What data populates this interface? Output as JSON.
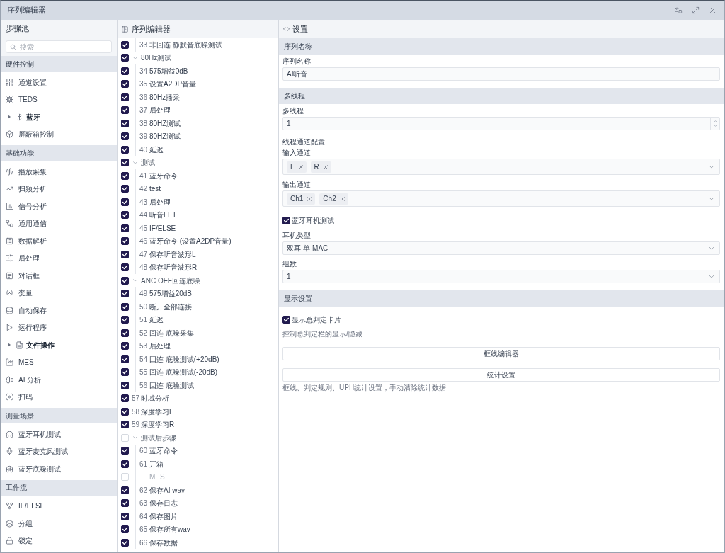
{
  "window": {
    "title": "序列编辑器"
  },
  "step_pool": {
    "title": "步骤池",
    "search": {
      "placeholder": "搜索"
    },
    "sections": [
      {
        "title": "硬件控制",
        "items": [
          {
            "kind": "tool",
            "label": "通道设置"
          },
          {
            "kind": "tool",
            "label": "TEDS"
          },
          {
            "kind": "group",
            "label": "蓝牙",
            "expanded": false
          },
          {
            "kind": "tool",
            "label": "屏蔽箱控制"
          }
        ]
      },
      {
        "title": "基础功能",
        "items": [
          {
            "kind": "tool",
            "label": "播放采集"
          },
          {
            "kind": "tool",
            "label": "扫频分析"
          },
          {
            "kind": "tool",
            "label": "信号分析"
          },
          {
            "kind": "tool",
            "label": "通用通信"
          },
          {
            "kind": "tool",
            "label": "数据解析"
          },
          {
            "kind": "tool",
            "label": "后处理"
          },
          {
            "kind": "tool",
            "label": "对话框"
          },
          {
            "kind": "tool",
            "label": "变量"
          },
          {
            "kind": "tool",
            "label": "自动保存"
          },
          {
            "kind": "tool",
            "label": "运行程序"
          },
          {
            "kind": "group",
            "label": "文件操作",
            "expanded": false
          },
          {
            "kind": "tool",
            "label": "MES"
          },
          {
            "kind": "tool",
            "label": "AI 分析"
          },
          {
            "kind": "tool",
            "label": "扫码"
          }
        ]
      },
      {
        "title": "测量场景",
        "items": [
          {
            "kind": "tool",
            "label": "蓝牙耳机测试"
          },
          {
            "kind": "tool",
            "label": "蓝牙麦克风测试"
          },
          {
            "kind": "tool",
            "label": "蓝牙底噪测试"
          }
        ]
      },
      {
        "title": "工作流",
        "items": [
          {
            "kind": "tool",
            "label": "IF/ELSE"
          },
          {
            "kind": "tool",
            "label": "分组"
          },
          {
            "kind": "tool",
            "label": "锁定"
          }
        ]
      }
    ]
  },
  "sequence_editor": {
    "title": "序列编辑器",
    "steps": [
      {
        "kind": "group",
        "children": [
          {
            "kind": "step",
            "number": "33",
            "label": "非回连 静默音底噪测试",
            "checked": true,
            "disabled": false
          }
        ]
      },
      {
        "kind": "group",
        "label": "80Hz测试",
        "checked": true,
        "expanded": true,
        "disabled": false,
        "children": [
          {
            "kind": "step",
            "number": "34",
            "label": "575增益0dB",
            "checked": true,
            "disabled": false
          },
          {
            "kind": "step",
            "number": "35",
            "label": "设置A2DP音量",
            "checked": true,
            "disabled": false
          },
          {
            "kind": "step",
            "number": "36",
            "label": "80Hz播采",
            "checked": true,
            "disabled": false
          },
          {
            "kind": "step",
            "number": "37",
            "label": "后处理",
            "checked": true,
            "disabled": false
          },
          {
            "kind": "step",
            "number": "38",
            "label": "80HZ测试",
            "checked": true,
            "disabled": false
          },
          {
            "kind": "step",
            "number": "39",
            "label": "80HZ测试",
            "checked": true,
            "disabled": false
          },
          {
            "kind": "step",
            "number": "40",
            "label": "延迟",
            "checked": true,
            "disabled": false
          }
        ]
      },
      {
        "kind": "group",
        "label": "测试",
        "checked": true,
        "expanded": true,
        "disabled": false,
        "children": [
          {
            "kind": "step",
            "number": "41",
            "label": "蓝牙命令",
            "checked": true,
            "disabled": false
          },
          {
            "kind": "step",
            "number": "42",
            "label": "test",
            "checked": true,
            "disabled": false
          },
          {
            "kind": "step",
            "number": "43",
            "label": "后处理",
            "checked": true,
            "disabled": false
          },
          {
            "kind": "step",
            "number": "44",
            "label": "听音FFT",
            "checked": true,
            "disabled": false
          },
          {
            "kind": "step",
            "number": "45",
            "label": "IF/ELSE",
            "checked": true,
            "disabled": false
          },
          {
            "kind": "step",
            "number": "46",
            "label": "蓝牙命令 (设置A2DP音量)",
            "checked": true,
            "disabled": false
          },
          {
            "kind": "step",
            "number": "47",
            "label": "保存听音波形L",
            "checked": true,
            "disabled": false
          },
          {
            "kind": "step",
            "number": "48",
            "label": "保存听音波形R",
            "checked": true,
            "disabled": false
          }
        ]
      },
      {
        "kind": "group",
        "label": "ANC OFF回连底噪",
        "checked": true,
        "expanded": true,
        "disabled": false,
        "children": [
          {
            "kind": "step",
            "number": "49",
            "label": "575增益20dB",
            "checked": true,
            "disabled": false
          },
          {
            "kind": "step",
            "number": "50",
            "label": "断开全部连接",
            "checked": true,
            "disabled": false
          },
          {
            "kind": "step",
            "number": "51",
            "label": "延迟",
            "checked": true,
            "disabled": false
          },
          {
            "kind": "step",
            "number": "52",
            "label": "回连 底噪采集",
            "checked": true,
            "disabled": false
          },
          {
            "kind": "step",
            "number": "53",
            "label": "后处理",
            "checked": true,
            "disabled": false
          },
          {
            "kind": "step",
            "number": "54",
            "label": "回连 底噪测试(+20dB)",
            "checked": true,
            "disabled": false
          },
          {
            "kind": "step",
            "number": "55",
            "label": "回连 底噪测试(-20dB)",
            "checked": true,
            "disabled": false
          },
          {
            "kind": "step",
            "number": "56",
            "label": "回连 底噪测试",
            "checked": true,
            "disabled": false
          }
        ]
      },
      {
        "kind": "step",
        "number": "57",
        "label": "时域分析",
        "checked": true,
        "disabled": false
      },
      {
        "kind": "step",
        "number": "58",
        "label": "深度学习L",
        "checked": true,
        "disabled": false
      },
      {
        "kind": "step",
        "number": "59",
        "label": "深度学习R",
        "checked": true,
        "disabled": false
      },
      {
        "kind": "group",
        "label": "测试后步骤",
        "checked": false,
        "expanded": true,
        "disabled": false,
        "children": [
          {
            "kind": "step",
            "number": "60",
            "label": "蓝牙命令",
            "checked": true,
            "disabled": false
          },
          {
            "kind": "step",
            "number": "61",
            "label": "开箱",
            "checked": true,
            "disabled": false
          },
          {
            "kind": "step",
            "label": "MES",
            "checked": false,
            "disabled": true
          },
          {
            "kind": "step",
            "number": "62",
            "label": "保存AI wav",
            "checked": true,
            "disabled": false
          },
          {
            "kind": "step",
            "number": "63",
            "label": "保存日志",
            "checked": true,
            "disabled": false
          },
          {
            "kind": "step",
            "number": "64",
            "label": "保存图片",
            "checked": true,
            "disabled": false
          },
          {
            "kind": "step",
            "number": "65",
            "label": "保存所有wav",
            "checked": true,
            "disabled": false
          },
          {
            "kind": "step",
            "number": "66",
            "label": "保存数据",
            "checked": true,
            "disabled": false
          }
        ]
      }
    ]
  },
  "settings": {
    "title": "设置",
    "sections": [
      {
        "title": "序列名称",
        "fields": [
          {
            "kind": "text",
            "label": "序列名称",
            "value": "AI听音"
          }
        ]
      },
      {
        "title": "多线程",
        "fields": [
          {
            "kind": "number",
            "label": "多线程",
            "value": "1"
          },
          {
            "kind": "heading",
            "label": "线程通道配置"
          },
          {
            "kind": "tags",
            "label": "输入通道",
            "tags": [
              "L",
              "R"
            ]
          },
          {
            "kind": "tags",
            "label": "输出通道",
            "tags": [
              "Ch1",
              "Ch2"
            ]
          },
          {
            "kind": "checkbox",
            "label": "蓝牙耳机测试",
            "checked": true
          },
          {
            "kind": "select",
            "label": "耳机类型",
            "value": "双耳-单 MAC"
          },
          {
            "kind": "select",
            "label": "组数",
            "value": "1"
          }
        ]
      },
      {
        "title": "显示设置",
        "fields": [
          {
            "kind": "checkbox",
            "label": "显示总判定卡片",
            "checked": true
          },
          {
            "kind": "hint",
            "text": "控制总判定栏的显示/隐藏"
          },
          {
            "kind": "button",
            "label": "框线编辑器"
          },
          {
            "kind": "button",
            "label": "统计设置"
          },
          {
            "kind": "hint",
            "text": "框线、判定规则、UPH统计设置，手动清除统计数据"
          }
        ]
      }
    ]
  }
}
